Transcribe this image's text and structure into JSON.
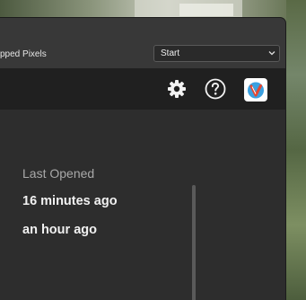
{
  "options_bar": {
    "label": "pped Pixels",
    "select_value": "Start"
  },
  "toolbar": {
    "icons": [
      "gear-icon",
      "help-icon",
      "app-logo-icon"
    ]
  },
  "recent": {
    "header": "Last Opened",
    "items": [
      {
        "time": "16 minutes ago"
      },
      {
        "time": "an hour ago"
      }
    ]
  },
  "colors": {
    "accent_blue": "#2a8fd4",
    "accent_red": "#e5452f",
    "panel_bg": "#2d2d2d",
    "toolbar_bg": "#202020"
  }
}
